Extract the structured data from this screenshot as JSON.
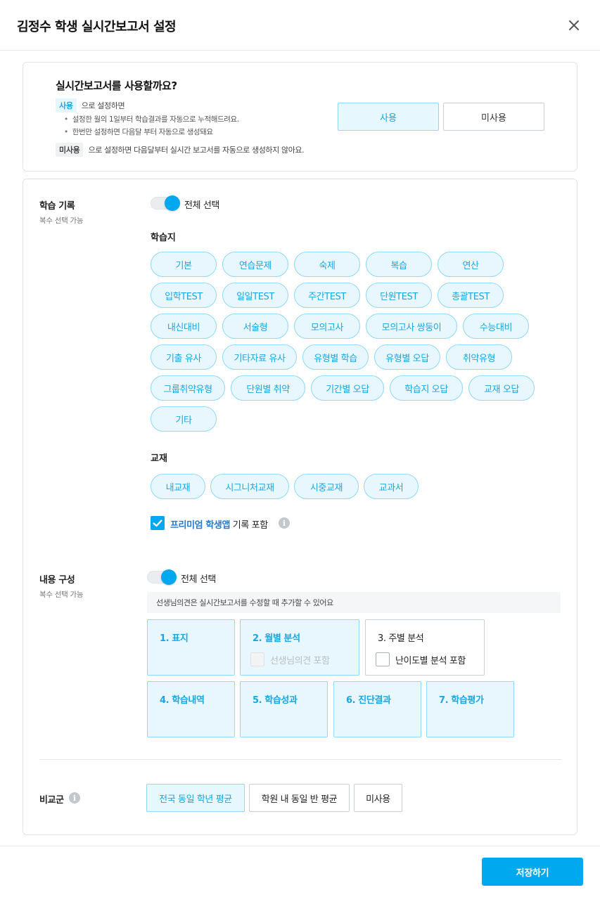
{
  "header": {
    "title": "김정수 학생 실시간보고서 설정"
  },
  "usage": {
    "question": "실시간보고서를 사용할까요?",
    "use_tag": "사용",
    "use_text": "으로 설정하면",
    "bullets": [
      "설정한 월의 1일부터 학습결과를 자동으로 누적해드려요.",
      "한번만 설정하면 다음달 부터 자동으로 생성돼요"
    ],
    "nouse_tag": "미사용",
    "nouse_text": "으로 설정하면 다음달부터 실시간 보고서를 자동으로 생성하지 않아요.",
    "use_button": "사용",
    "nouse_button": "미사용"
  },
  "learning": {
    "label": "학습 기록",
    "sub": "복수 선택 가능",
    "select_all": "전체 선택",
    "worksheet_title": "학습지",
    "worksheets": [
      [
        "기본",
        "연습문제",
        "숙제",
        "복습",
        "연산"
      ],
      [
        "입학TEST",
        "일일TEST",
        "주간TEST",
        "단원TEST",
        "총괄TEST"
      ],
      [
        "내신대비",
        "서술형",
        "모의고사",
        "모의고사 쌍둥이",
        "수능대비"
      ],
      [
        "기출 유사",
        "기타자료 유사",
        "유형별 학습",
        "유형별 오답",
        "취약유형"
      ],
      [
        "그룹취약유형",
        "단원별 취약",
        "기간별 오답",
        "학습지 오답",
        "교재 오답"
      ],
      [
        "기타"
      ]
    ],
    "textbook_title": "교재",
    "textbooks": [
      "내교재",
      "시그니처교재",
      "시중교재",
      "교과서"
    ],
    "premium_highlight": "프리미엄 학생앱",
    "premium_rest": " 기록 포함"
  },
  "content": {
    "label": "내용 구성",
    "sub": "복수 선택 가능",
    "select_all": "전체 선택",
    "notice": "선생님의견은 실시간보고서를 수정할 때 추가할 수 있어요",
    "items": [
      {
        "title": "1. 표지"
      },
      {
        "title": "2. 월별 분석",
        "sub": "선생님의견 포함"
      },
      {
        "title": "3. 주별 분석",
        "sub": "난이도별 분석 포함"
      },
      {
        "title": "4. 학습내역"
      },
      {
        "title": "5. 학습성과"
      },
      {
        "title": "6. 진단결과"
      },
      {
        "title": "7. 학습평가"
      }
    ]
  },
  "comparison": {
    "label": "비교군",
    "options": [
      "전국 동일 학년 평균",
      "학원 내 동일 반 평균",
      "미사용"
    ]
  },
  "footer": {
    "save": "저장하기"
  }
}
